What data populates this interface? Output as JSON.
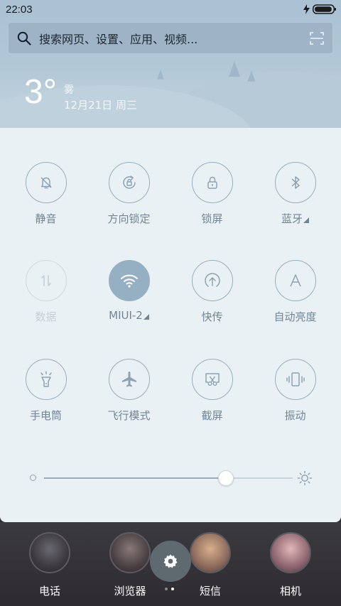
{
  "status": {
    "time": "22:03",
    "battery_level": 0.95
  },
  "search": {
    "placeholder": "搜索网页、设置、应用、视频..."
  },
  "weather": {
    "temperature": "3°",
    "condition": "雾",
    "date": "12月21日 周三"
  },
  "toggles": [
    {
      "label": "静音",
      "icon": "bell-off-icon",
      "state": "off"
    },
    {
      "label": "方向锁定",
      "icon": "rotation-lock-icon",
      "state": "off"
    },
    {
      "label": "锁屏",
      "icon": "lock-icon",
      "state": "off"
    },
    {
      "label": "蓝牙",
      "icon": "bluetooth-icon",
      "state": "off",
      "has_more": true
    },
    {
      "label": "数据",
      "icon": "data-arrows-icon",
      "state": "disabled"
    },
    {
      "label": "MIUI-2",
      "icon": "wifi-icon",
      "state": "on",
      "has_more": true
    },
    {
      "label": "快传",
      "icon": "upload-icon",
      "state": "off"
    },
    {
      "label": "自动亮度",
      "icon": "auto-brightness-icon",
      "state": "off"
    },
    {
      "label": "手电筒",
      "icon": "flashlight-icon",
      "state": "off"
    },
    {
      "label": "飞行模式",
      "icon": "airplane-icon",
      "state": "off"
    },
    {
      "label": "截屏",
      "icon": "screenshot-icon",
      "state": "off"
    },
    {
      "label": "振动",
      "icon": "vibrate-icon",
      "state": "off"
    }
  ],
  "brightness": {
    "value": 0.73
  },
  "dock": {
    "apps": [
      {
        "label": "电话"
      },
      {
        "label": "浏览器"
      },
      {
        "label": "短信"
      },
      {
        "label": "相机"
      }
    ],
    "page_count": 2,
    "current_page": 2
  },
  "colors": {
    "accent": "#95afc3",
    "panel_bg": "#eaf1f5",
    "label": "#6f8597"
  }
}
